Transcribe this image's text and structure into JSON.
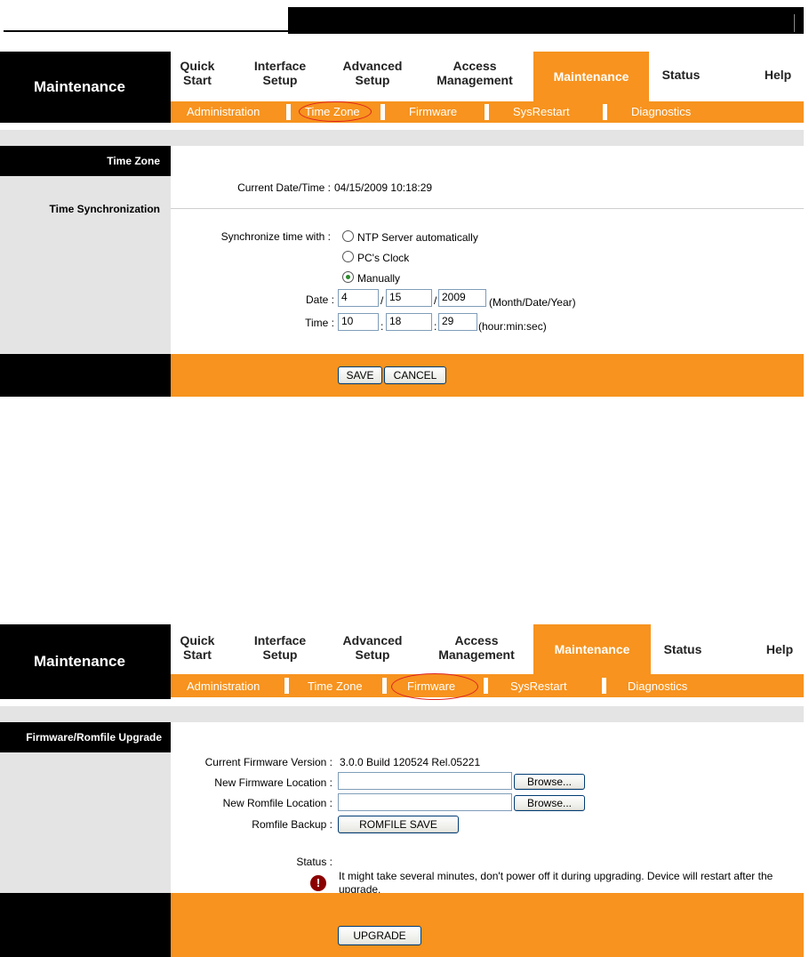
{
  "screen1": {
    "header": {
      "title": "Maintenance"
    },
    "menu": [
      {
        "label": "Quick\nStart"
      },
      {
        "label": "Interface\nSetup"
      },
      {
        "label": "Advanced\nSetup"
      },
      {
        "label": "Access\nManagement"
      },
      {
        "label": "Maintenance"
      },
      {
        "label": "Status"
      },
      {
        "label": "Help"
      }
    ],
    "subnav": [
      "Administration",
      "Time Zone",
      "Firmware",
      "SysRestart",
      "Diagnostics"
    ],
    "sidebar": {
      "section1": "Time Zone",
      "section2": "Time Synchronization"
    },
    "current_datetime": {
      "label": "Current Date/Time :",
      "value": "04/15/2009 10:18:29"
    },
    "sync": {
      "label": "Synchronize time with :",
      "options": [
        "NTP Server automatically",
        "PC's Clock",
        "Manually"
      ],
      "selected": "Manually"
    },
    "date": {
      "label": "Date :",
      "month": "4",
      "day": "15",
      "year": "2009",
      "hint": "(Month/Date/Year)"
    },
    "time": {
      "label": "Time :",
      "hour": "10",
      "min": "18",
      "sec": "29",
      "hint": "(hour:min:sec)"
    },
    "buttons": {
      "save": "SAVE",
      "cancel": "CANCEL"
    }
  },
  "screen2": {
    "header": {
      "title": "Maintenance"
    },
    "menu": [
      {
        "label": "Quick\nStart"
      },
      {
        "label": "Interface\nSetup"
      },
      {
        "label": "Advanced\nSetup"
      },
      {
        "label": "Access\nManagement"
      },
      {
        "label": "Maintenance"
      },
      {
        "label": "Status"
      },
      {
        "label": "Help"
      }
    ],
    "subnav": [
      "Administration",
      "Time Zone",
      "Firmware",
      "SysRestart",
      "Diagnostics"
    ],
    "sidebar": {
      "section1": "Firmware/Romfile Upgrade"
    },
    "firmware_version": {
      "label": "Current Firmware Version :",
      "value": "3.0.0 Build 120524 Rel.05221"
    },
    "new_firmware": {
      "label": "New Firmware Location :",
      "value": "",
      "browse": "Browse..."
    },
    "new_romfile": {
      "label": "New Romfile Location :",
      "value": "",
      "browse": "Browse..."
    },
    "romfile_backup": {
      "label": "Romfile Backup :",
      "button": "ROMFILE SAVE"
    },
    "status": {
      "label": "Status :",
      "message": "It might take several minutes, don't power off it during upgrading. Device will restart after the upgrade."
    },
    "buttons": {
      "upgrade": "UPGRADE"
    }
  },
  "colors": {
    "accent": "#f7931e",
    "dark": "#000000",
    "panel": "#e4e4e4",
    "highlight": "#dd2222"
  }
}
